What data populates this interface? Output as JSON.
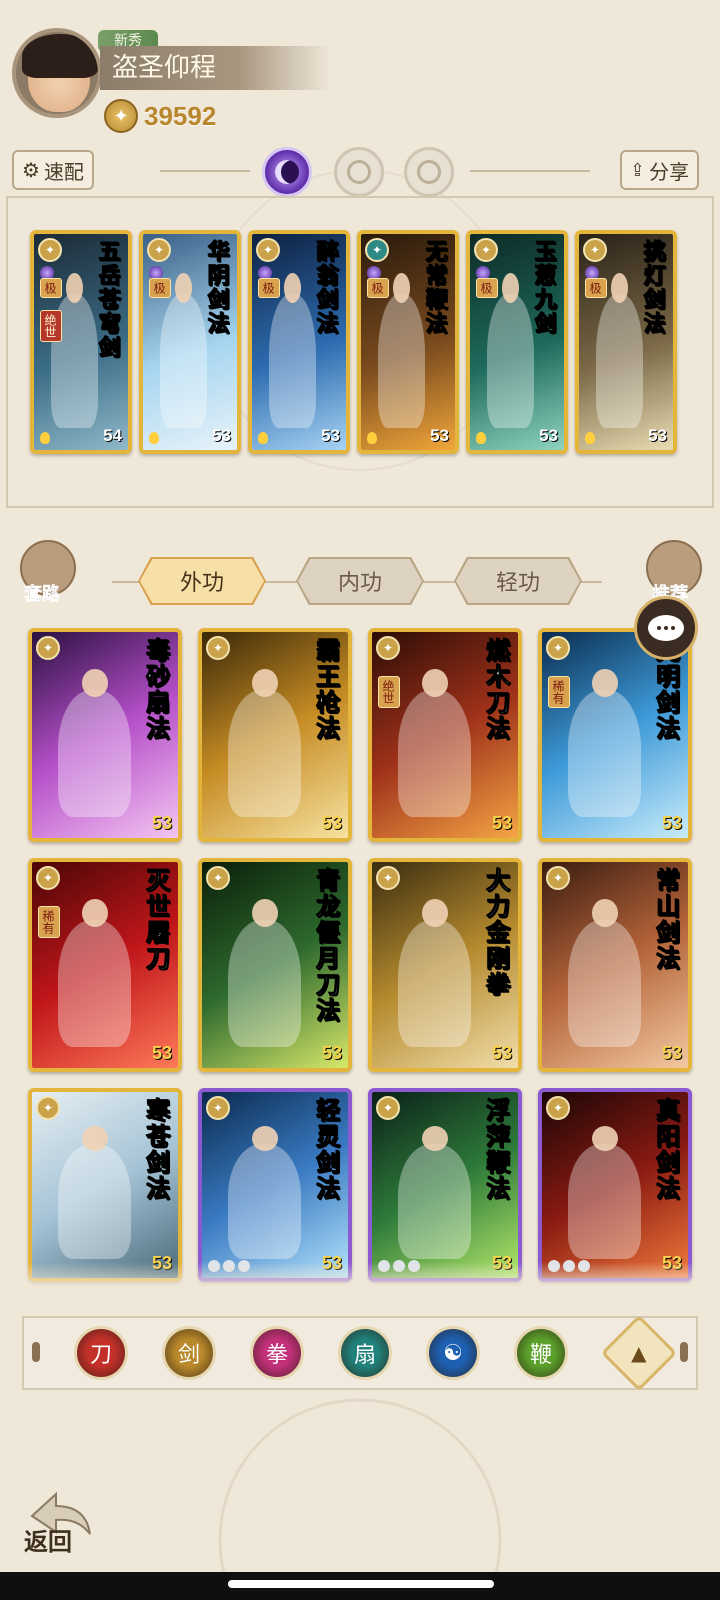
{
  "player": {
    "rank_badge": "新秀",
    "name": "盗圣仰程",
    "power": "39592"
  },
  "toolbar": {
    "quick_config": "速配",
    "share": "分享"
  },
  "deck": [
    {
      "title": "五岳苍穹剑",
      "level": "54",
      "tags": [
        "极",
        "绝世"
      ],
      "bg": [
        "#1c2a36",
        "#3a6c85",
        "#8fb8c9"
      ],
      "school": "gold"
    },
    {
      "title": "华阴剑法",
      "level": "53",
      "tags": [
        "极"
      ],
      "bg": [
        "#3a5f86",
        "#a6d5ef",
        "#e8f3fa"
      ],
      "school": "gold"
    },
    {
      "title": "醉翁剑法",
      "level": "53",
      "tags": [
        "极"
      ],
      "bg": [
        "#0e2140",
        "#2d6cb0",
        "#a7d2f2"
      ],
      "school": "gold"
    },
    {
      "title": "无常鞭法",
      "level": "53",
      "tags": [
        "极"
      ],
      "bg": [
        "#2a1a0c",
        "#7a4b1e",
        "#f0a63a"
      ],
      "school": "teal"
    },
    {
      "title": "玉葱九剑",
      "level": "53",
      "tags": [
        "极"
      ],
      "bg": [
        "#0d2a26",
        "#1e6a5c",
        "#8fd3c0"
      ],
      "school": "gold"
    },
    {
      "title": "挑灯剑法",
      "level": "53",
      "tags": [
        "极"
      ],
      "bg": [
        "#2a2218",
        "#7a6846",
        "#e9dcb2"
      ],
      "school": "gold"
    }
  ],
  "tabs": {
    "left_corner": "套路",
    "right_corner": "推荐",
    "items": [
      "外功",
      "内功",
      "轻功"
    ]
  },
  "skills": [
    {
      "title": "毒砂扇法",
      "level": "53",
      "bg": [
        "#2a1040",
        "#b54fc9",
        "#f4c6f2"
      ],
      "tag": "",
      "frame": "gold"
    },
    {
      "title": "霸王枪法",
      "level": "53",
      "bg": [
        "#3a2808",
        "#c68c24",
        "#f7e2a0"
      ],
      "tag": "",
      "frame": "gold"
    },
    {
      "title": "燃木刀法",
      "level": "53",
      "bg": [
        "#2c0c06",
        "#a0321a",
        "#f5a545"
      ],
      "tag": "绝世",
      "frame": "gold"
    },
    {
      "title": "光明剑法",
      "level": "53",
      "bg": [
        "#0a2c4e",
        "#3e9ad8",
        "#c9ecfb"
      ],
      "tag": "稀有",
      "frame": "gold"
    },
    {
      "title": "灭世屠刀",
      "level": "53",
      "bg": [
        "#4a0606",
        "#c0161a",
        "#ff7a5a"
      ],
      "tag": "稀有",
      "frame": "gold"
    },
    {
      "title": "青龙偃月刀法",
      "level": "53",
      "bg": [
        "#0a1e0a",
        "#2e6a2e",
        "#d7e86a"
      ],
      "tag": "",
      "frame": "gold"
    },
    {
      "title": "大力金刚拳",
      "level": "53",
      "bg": [
        "#3a2c10",
        "#b58a2e",
        "#f1deaa"
      ],
      "tag": "",
      "frame": "gold"
    },
    {
      "title": "常山剑法",
      "level": "53",
      "bg": [
        "#3a1c10",
        "#b5643a",
        "#f3c9a2"
      ],
      "tag": "",
      "frame": "gold"
    },
    {
      "title": "寒苍剑法",
      "level": "53",
      "bg": [
        "#e6eef2",
        "#a6c4d6",
        "#4a6a7a"
      ],
      "tag": "",
      "frame": "gold"
    },
    {
      "title": "轻灵剑法",
      "level": "53",
      "bg": [
        "#0a2a4e",
        "#3a7ac2",
        "#b3e2fb"
      ],
      "tag": "",
      "frame": "purple"
    },
    {
      "title": "浮萍鞭法",
      "level": "53",
      "bg": [
        "#0a2018",
        "#2e7a3a",
        "#b3e86a"
      ],
      "tag": "",
      "frame": "purple"
    },
    {
      "title": "真阳剑法",
      "level": "53",
      "bg": [
        "#1a0606",
        "#8a1a12",
        "#f07a3a"
      ],
      "tag": "",
      "frame": "purple"
    }
  ],
  "filters": [
    {
      "name": "blade-school-icon",
      "color": "#c3302a"
    },
    {
      "name": "sword-school-icon",
      "color": "#b8882a"
    },
    {
      "name": "fist-school-icon",
      "color": "#c2307a"
    },
    {
      "name": "fan-school-icon",
      "color": "#20807a"
    },
    {
      "name": "yin-yang-school-icon",
      "color": "#1d5fb0"
    },
    {
      "name": "whip-school-icon",
      "color": "#5aa02a"
    }
  ],
  "nav": {
    "back": "返回"
  }
}
